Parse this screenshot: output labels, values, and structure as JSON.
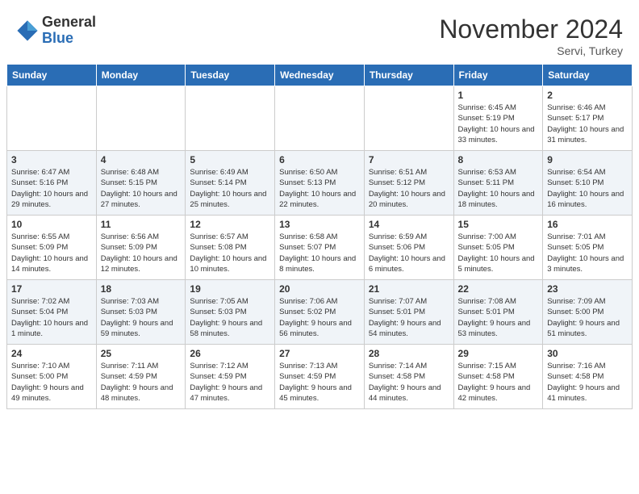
{
  "logo": {
    "general": "General",
    "blue": "Blue"
  },
  "title": "November 2024",
  "location": "Servi, Turkey",
  "days_of_week": [
    "Sunday",
    "Monday",
    "Tuesday",
    "Wednesday",
    "Thursday",
    "Friday",
    "Saturday"
  ],
  "weeks": [
    [
      {
        "day": "",
        "info": ""
      },
      {
        "day": "",
        "info": ""
      },
      {
        "day": "",
        "info": ""
      },
      {
        "day": "",
        "info": ""
      },
      {
        "day": "",
        "info": ""
      },
      {
        "day": "1",
        "info": "Sunrise: 6:45 AM\nSunset: 5:19 PM\nDaylight: 10 hours and 33 minutes."
      },
      {
        "day": "2",
        "info": "Sunrise: 6:46 AM\nSunset: 5:17 PM\nDaylight: 10 hours and 31 minutes."
      }
    ],
    [
      {
        "day": "3",
        "info": "Sunrise: 6:47 AM\nSunset: 5:16 PM\nDaylight: 10 hours and 29 minutes."
      },
      {
        "day": "4",
        "info": "Sunrise: 6:48 AM\nSunset: 5:15 PM\nDaylight: 10 hours and 27 minutes."
      },
      {
        "day": "5",
        "info": "Sunrise: 6:49 AM\nSunset: 5:14 PM\nDaylight: 10 hours and 25 minutes."
      },
      {
        "day": "6",
        "info": "Sunrise: 6:50 AM\nSunset: 5:13 PM\nDaylight: 10 hours and 22 minutes."
      },
      {
        "day": "7",
        "info": "Sunrise: 6:51 AM\nSunset: 5:12 PM\nDaylight: 10 hours and 20 minutes."
      },
      {
        "day": "8",
        "info": "Sunrise: 6:53 AM\nSunset: 5:11 PM\nDaylight: 10 hours and 18 minutes."
      },
      {
        "day": "9",
        "info": "Sunrise: 6:54 AM\nSunset: 5:10 PM\nDaylight: 10 hours and 16 minutes."
      }
    ],
    [
      {
        "day": "10",
        "info": "Sunrise: 6:55 AM\nSunset: 5:09 PM\nDaylight: 10 hours and 14 minutes."
      },
      {
        "day": "11",
        "info": "Sunrise: 6:56 AM\nSunset: 5:09 PM\nDaylight: 10 hours and 12 minutes."
      },
      {
        "day": "12",
        "info": "Sunrise: 6:57 AM\nSunset: 5:08 PM\nDaylight: 10 hours and 10 minutes."
      },
      {
        "day": "13",
        "info": "Sunrise: 6:58 AM\nSunset: 5:07 PM\nDaylight: 10 hours and 8 minutes."
      },
      {
        "day": "14",
        "info": "Sunrise: 6:59 AM\nSunset: 5:06 PM\nDaylight: 10 hours and 6 minutes."
      },
      {
        "day": "15",
        "info": "Sunrise: 7:00 AM\nSunset: 5:05 PM\nDaylight: 10 hours and 5 minutes."
      },
      {
        "day": "16",
        "info": "Sunrise: 7:01 AM\nSunset: 5:05 PM\nDaylight: 10 hours and 3 minutes."
      }
    ],
    [
      {
        "day": "17",
        "info": "Sunrise: 7:02 AM\nSunset: 5:04 PM\nDaylight: 10 hours and 1 minute."
      },
      {
        "day": "18",
        "info": "Sunrise: 7:03 AM\nSunset: 5:03 PM\nDaylight: 9 hours and 59 minutes."
      },
      {
        "day": "19",
        "info": "Sunrise: 7:05 AM\nSunset: 5:03 PM\nDaylight: 9 hours and 58 minutes."
      },
      {
        "day": "20",
        "info": "Sunrise: 7:06 AM\nSunset: 5:02 PM\nDaylight: 9 hours and 56 minutes."
      },
      {
        "day": "21",
        "info": "Sunrise: 7:07 AM\nSunset: 5:01 PM\nDaylight: 9 hours and 54 minutes."
      },
      {
        "day": "22",
        "info": "Sunrise: 7:08 AM\nSunset: 5:01 PM\nDaylight: 9 hours and 53 minutes."
      },
      {
        "day": "23",
        "info": "Sunrise: 7:09 AM\nSunset: 5:00 PM\nDaylight: 9 hours and 51 minutes."
      }
    ],
    [
      {
        "day": "24",
        "info": "Sunrise: 7:10 AM\nSunset: 5:00 PM\nDaylight: 9 hours and 49 minutes."
      },
      {
        "day": "25",
        "info": "Sunrise: 7:11 AM\nSunset: 4:59 PM\nDaylight: 9 hours and 48 minutes."
      },
      {
        "day": "26",
        "info": "Sunrise: 7:12 AM\nSunset: 4:59 PM\nDaylight: 9 hours and 47 minutes."
      },
      {
        "day": "27",
        "info": "Sunrise: 7:13 AM\nSunset: 4:59 PM\nDaylight: 9 hours and 45 minutes."
      },
      {
        "day": "28",
        "info": "Sunrise: 7:14 AM\nSunset: 4:58 PM\nDaylight: 9 hours and 44 minutes."
      },
      {
        "day": "29",
        "info": "Sunrise: 7:15 AM\nSunset: 4:58 PM\nDaylight: 9 hours and 42 minutes."
      },
      {
        "day": "30",
        "info": "Sunrise: 7:16 AM\nSunset: 4:58 PM\nDaylight: 9 hours and 41 minutes."
      }
    ]
  ]
}
